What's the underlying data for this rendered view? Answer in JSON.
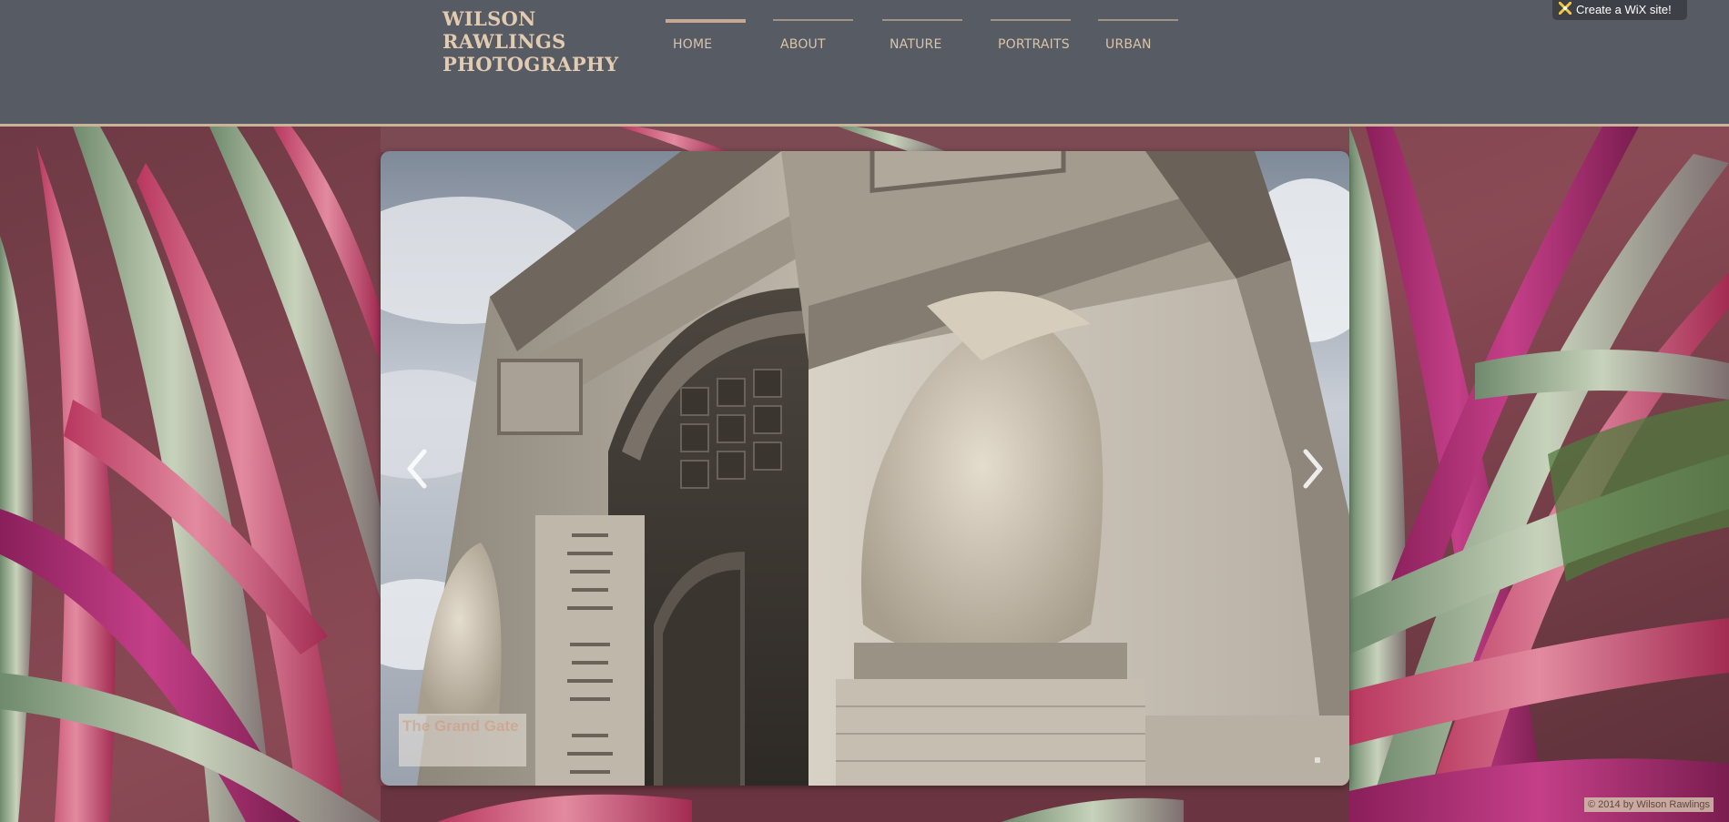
{
  "site": {
    "title_line1": "WILSON RAWLINGS",
    "title_line2": "PHOTOGRAPHY"
  },
  "nav": {
    "items": [
      {
        "label": "HOME",
        "active": true
      },
      {
        "label": "ABOUT",
        "active": false
      },
      {
        "label": "NATURE",
        "active": false
      },
      {
        "label": "PORTRAITS",
        "active": false
      },
      {
        "label": "URBAN",
        "active": false
      }
    ]
  },
  "wix_badge": {
    "label": "Create a WiX site!",
    "icon": "wix-x-icon"
  },
  "slideshow": {
    "caption": "The Grand Gate",
    "prev_icon": "chevron-left-icon",
    "next_icon": "chevron-right-icon"
  },
  "footer": {
    "credit": "© 2014 by Wilson Rawlings"
  },
  "colors": {
    "header_bg": "#575b63",
    "title": "#e2cbb1",
    "nav_text": "#d9c4aa",
    "accent_rule": "#c9b49b"
  }
}
